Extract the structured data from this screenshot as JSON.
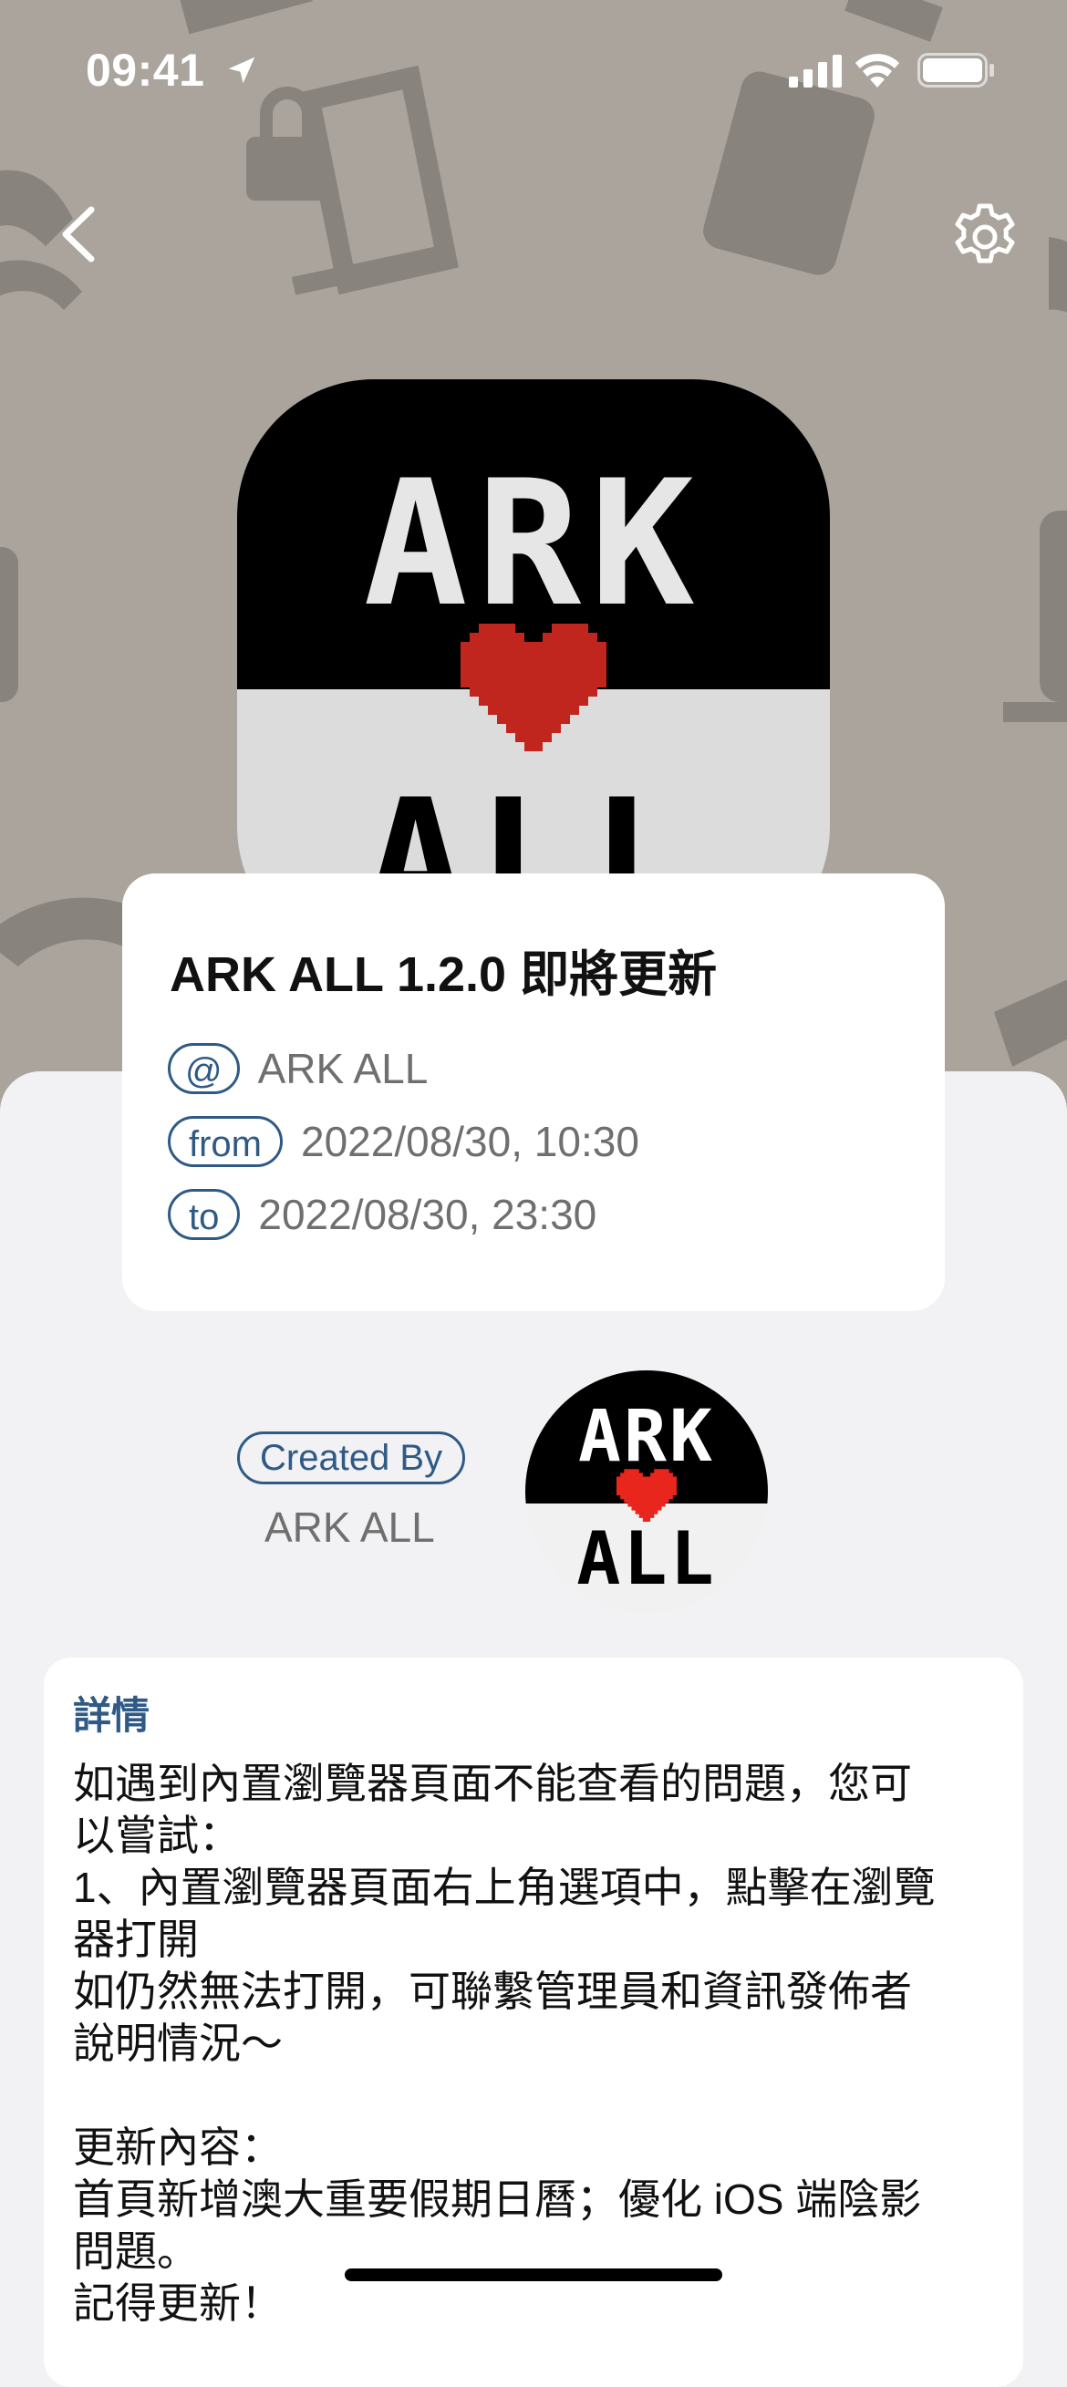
{
  "status_bar": {
    "time": "09:41",
    "icons": [
      "location-arrow-icon",
      "cellular-signal-icon",
      "wifi-icon",
      "battery-icon"
    ]
  },
  "nav": {
    "back_icon": "chevron-left-icon",
    "settings_icon": "gear-icon"
  },
  "app_logo": {
    "top_text": "ARK",
    "bottom_text": "ALL",
    "heart_color": "#c0261d"
  },
  "event": {
    "title": "ARK ALL 1.2.0 即將更新",
    "at_label": "@",
    "at_value": "ARK ALL",
    "from_label": "from",
    "from_value": "2022/08/30, 10:30",
    "to_label": "to",
    "to_value": "2022/08/30, 23:30"
  },
  "creator": {
    "label": "Created By",
    "name": "ARK ALL",
    "avatar_top_text": "ARK",
    "avatar_bottom_text": "ALL"
  },
  "details": {
    "heading": "詳情",
    "lines": [
      "如遇到內置瀏覽器頁面不能查看的問題，您可",
      "以嘗試：",
      "1、內置瀏覽器頁面右上角選項中，點擊在瀏覽",
      "器打開",
      "如仍然無法打開，可聯繫管理員和資訊發佈者",
      "說明情況～",
      "",
      "更新內容：",
      "首頁新增澳大重要假期日曆；優化 iOS 端陰影",
      "問題。",
      "記得更新！"
    ]
  },
  "colors": {
    "hero_bg": "#aaa49d",
    "accent_blue": "#2f5a85",
    "page_bg": "#f2f2f4"
  }
}
